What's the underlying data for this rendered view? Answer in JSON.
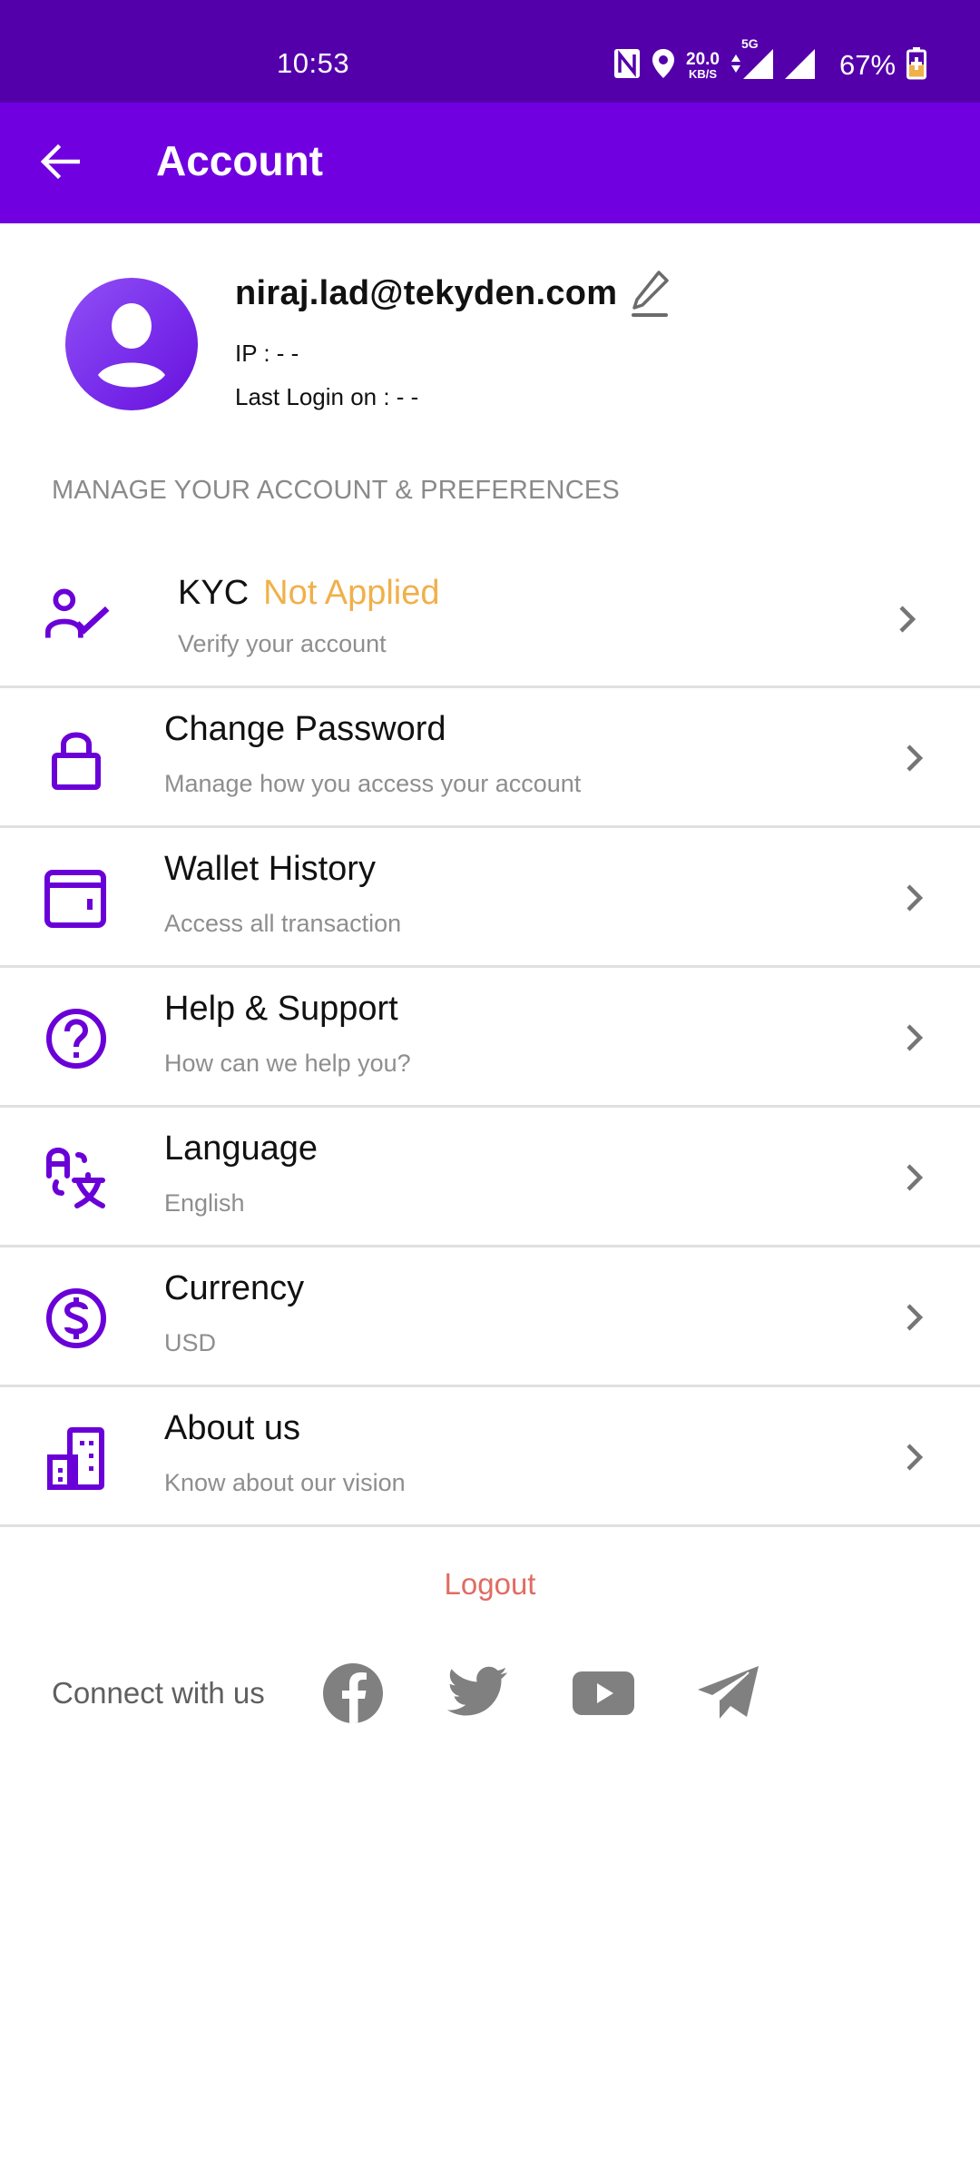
{
  "status_bar": {
    "time": "10:53",
    "net_speed_value": "20.0",
    "net_speed_unit": "KB/S",
    "network_type": "5G",
    "battery_percent": "67%",
    "icons": [
      "nfc-icon",
      "location-icon",
      "data-arrows-icon",
      "signal-icon",
      "signal-icon",
      "battery-charging-icon"
    ]
  },
  "app_bar": {
    "title": "Account",
    "back_icon": "arrow-left-icon"
  },
  "profile": {
    "email": "niraj.lad@tekyden.com",
    "ip": "IP : - -",
    "last_login": "Last Login on : - -",
    "edit_icon": "pencil-icon"
  },
  "section_header": "MANAGE YOUR ACCOUNT & PREFERENCES",
  "menu": {
    "items": [
      {
        "icon": "user-check-icon",
        "title": "KYC",
        "status": "Not Applied",
        "subtitle": "Verify your account"
      },
      {
        "icon": "lock-icon",
        "title": "Change Password",
        "subtitle": "Manage how you access your account"
      },
      {
        "icon": "wallet-icon",
        "title": "Wallet History",
        "subtitle": "Access all transaction"
      },
      {
        "icon": "help-circle-icon",
        "title": "Help & Support",
        "subtitle": "How can we help you?"
      },
      {
        "icon": "translate-icon",
        "title": "Language",
        "subtitle": "English"
      },
      {
        "icon": "dollar-circle-icon",
        "title": "Currency",
        "subtitle": "USD"
      },
      {
        "icon": "building-icon",
        "title": "About us",
        "subtitle": "Know about our vision"
      }
    ]
  },
  "logout_label": "Logout",
  "connect": {
    "label": "Connect with us",
    "socials": [
      "facebook-icon",
      "twitter-icon",
      "youtube-icon",
      "telegram-icon"
    ]
  },
  "colors": {
    "status_bar": "#5400aa",
    "app_bar": "#7000e0",
    "accent": "#6a00d8",
    "kyc_status": "#f0b04a",
    "logout": "#e06c62",
    "muted_text": "#8e8e8e",
    "social_icon": "#808080"
  }
}
